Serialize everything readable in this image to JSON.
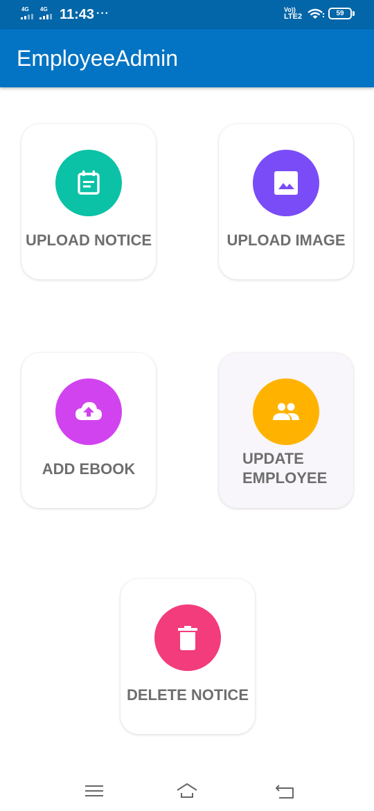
{
  "status_bar": {
    "network_1": "4G",
    "network_2": "4G",
    "time": "11:43",
    "more_indicator": "···",
    "volte_top": "Vo))",
    "volte_bottom": "LTE2",
    "battery_level": "59"
  },
  "app_bar": {
    "title": "EmployeeAdmin"
  },
  "cards": {
    "upload_notice": {
      "label": "UPLOAD NOTICE",
      "icon": "calendar-note-icon",
      "color": "#0BC2A6"
    },
    "upload_image": {
      "label": "UPLOAD IMAGE",
      "icon": "image-icon",
      "color": "#7A4CF7"
    },
    "add_ebook": {
      "label": "ADD EBOOK",
      "icon": "cloud-upload-icon",
      "color": "#D243F0"
    },
    "update_employee": {
      "label": "UPDATE\nEMPLOYEE",
      "icon": "people-icon",
      "color": "#FFB300"
    },
    "delete_notice": {
      "label": "DELETE NOTICE",
      "icon": "trash-icon",
      "color": "#F23C7C"
    }
  },
  "nav_bar": {
    "menu_icon": "menu-icon",
    "home_icon": "home-icon",
    "back_icon": "back-icon"
  },
  "colors": {
    "status_bar": "#0366A8",
    "app_bar": "#0373C3",
    "label_text": "#6E6E6E"
  }
}
